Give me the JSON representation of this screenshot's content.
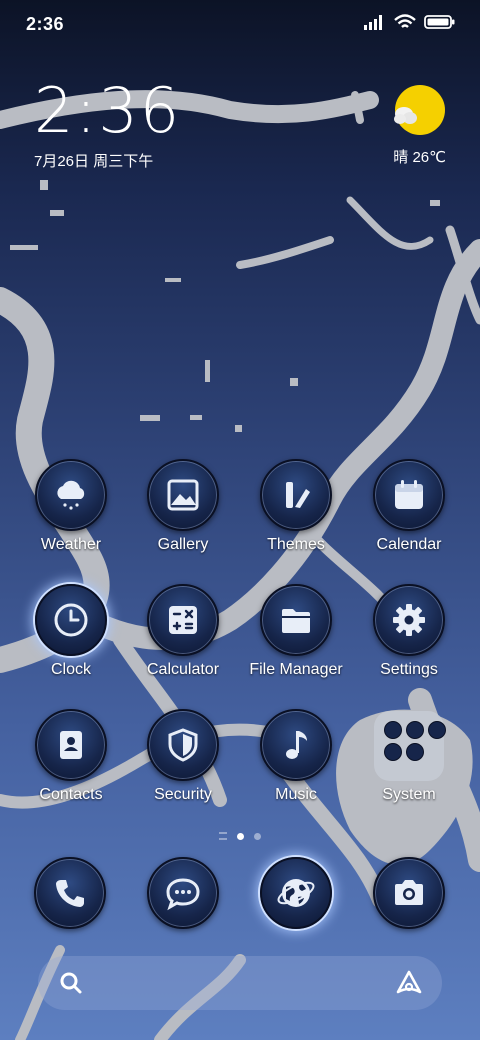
{
  "status_bar": {
    "time": "2:36",
    "icons": [
      "signal-icon",
      "wifi-icon",
      "battery-icon"
    ]
  },
  "clock_widget": {
    "time": "2:36",
    "date": "7月26日 周三下午"
  },
  "weather_widget": {
    "condition": "晴",
    "temperature": "26℃",
    "text": "晴 26℃",
    "icon": "sun-cloud-icon"
  },
  "apps": [
    {
      "label": "Weather",
      "icon": "cloud-rain-icon"
    },
    {
      "label": "Gallery",
      "icon": "image-icon"
    },
    {
      "label": "Themes",
      "icon": "brush-icon"
    },
    {
      "label": "Calendar",
      "icon": "calendar-icon"
    },
    {
      "label": "Clock",
      "icon": "clock-icon"
    },
    {
      "label": "Calculator",
      "icon": "calculator-icon"
    },
    {
      "label": "File Manager",
      "icon": "folder-icon"
    },
    {
      "label": "Settings",
      "icon": "gear-icon"
    },
    {
      "label": "Contacts",
      "icon": "contacts-icon"
    },
    {
      "label": "Security",
      "icon": "shield-icon"
    },
    {
      "label": "Music",
      "icon": "music-note-icon"
    },
    {
      "label": "System",
      "icon": "folder-group-icon"
    }
  ],
  "page_indicator": {
    "pages": 2,
    "current": 1
  },
  "dock": [
    {
      "name": "Phone",
      "icon": "phone-icon"
    },
    {
      "name": "Messages",
      "icon": "chat-icon"
    },
    {
      "name": "Browser",
      "icon": "globe-icon"
    },
    {
      "name": "Camera",
      "icon": "camera-icon"
    }
  ],
  "search_bar": {
    "icon": "search-icon",
    "assistant_icon": "assistant-icon"
  },
  "colors": {
    "accent": "#f5d000",
    "icon_fill": "#16254a",
    "glow": "#cfe0ff"
  }
}
